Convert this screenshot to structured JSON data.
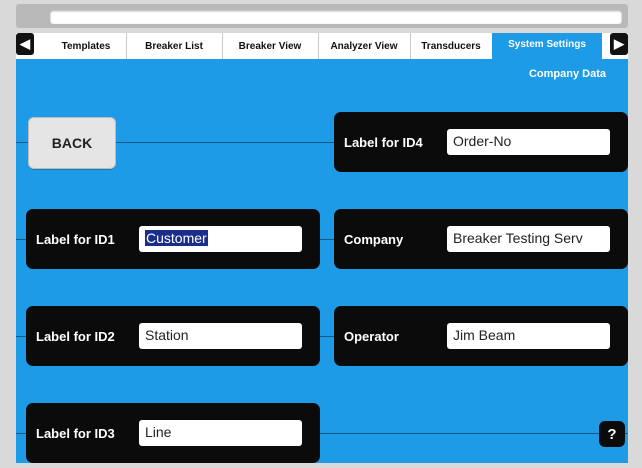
{
  "nav": {
    "prev_icon": "left-arrow-icon",
    "next_icon": "right-arrow-icon",
    "tabs": [
      {
        "label": "Templates"
      },
      {
        "label": "Breaker List"
      },
      {
        "label": "Breaker View"
      },
      {
        "label": "Analyzer View"
      },
      {
        "label": "Transducers"
      },
      {
        "label": "System Settings"
      }
    ]
  },
  "page": {
    "subtitle": "Company Data"
  },
  "back_label": "BACK",
  "fields": {
    "id1": {
      "label": "Label for ID1",
      "value": "Customer"
    },
    "id2": {
      "label": "Label for ID2",
      "value": "Station"
    },
    "id3": {
      "label": "Label for ID3",
      "value": "Line"
    },
    "id4": {
      "label": "Label for ID4",
      "value": "Order-No"
    },
    "company": {
      "label": "Company",
      "value": "Breaker Testing Serv"
    },
    "operator": {
      "label": "Operator",
      "value": "Jim Beam"
    }
  },
  "help_label": "?",
  "colors": {
    "accent": "#1e9be6",
    "card": "#0b0b0b"
  }
}
